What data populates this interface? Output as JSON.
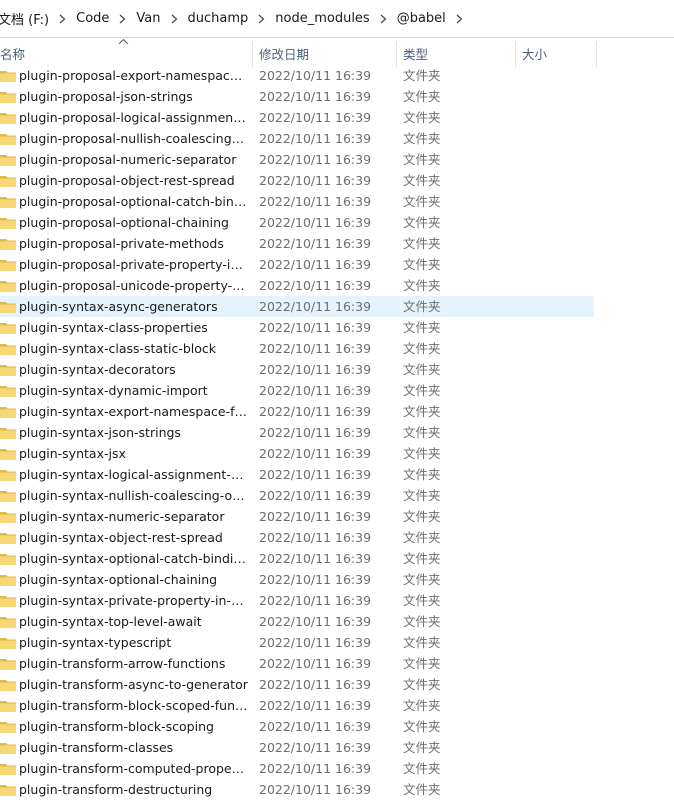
{
  "breadcrumb": [
    {
      "label": "文档 (F:)"
    },
    {
      "label": "Code"
    },
    {
      "label": "Van"
    },
    {
      "label": "duchamp"
    },
    {
      "label": "node_modules"
    },
    {
      "label": "@babel"
    }
  ],
  "columns": {
    "name": "名称",
    "date": "修改日期",
    "type": "类型",
    "size": "大小"
  },
  "colors": {
    "selected_row": "#e5f3ff",
    "folder": "#f8d775",
    "folder_dark": "#e0b94a",
    "header_text": "#4c607a"
  },
  "files": [
    {
      "name": "plugin-proposal-export-namespace-f...",
      "date": "2022/10/11 16:39",
      "type": "文件夹"
    },
    {
      "name": "plugin-proposal-json-strings",
      "date": "2022/10/11 16:39",
      "type": "文件夹"
    },
    {
      "name": "plugin-proposal-logical-assignment-...",
      "date": "2022/10/11 16:39",
      "type": "文件夹"
    },
    {
      "name": "plugin-proposal-nullish-coalescing-o...",
      "date": "2022/10/11 16:39",
      "type": "文件夹"
    },
    {
      "name": "plugin-proposal-numeric-separator",
      "date": "2022/10/11 16:39",
      "type": "文件夹"
    },
    {
      "name": "plugin-proposal-object-rest-spread",
      "date": "2022/10/11 16:39",
      "type": "文件夹"
    },
    {
      "name": "plugin-proposal-optional-catch-bindi...",
      "date": "2022/10/11 16:39",
      "type": "文件夹"
    },
    {
      "name": "plugin-proposal-optional-chaining",
      "date": "2022/10/11 16:39",
      "type": "文件夹"
    },
    {
      "name": "plugin-proposal-private-methods",
      "date": "2022/10/11 16:39",
      "type": "文件夹"
    },
    {
      "name": "plugin-proposal-private-property-in-...",
      "date": "2022/10/11 16:39",
      "type": "文件夹"
    },
    {
      "name": "plugin-proposal-unicode-property-r...",
      "date": "2022/10/11 16:39",
      "type": "文件夹"
    },
    {
      "name": "plugin-syntax-async-generators",
      "date": "2022/10/11 16:39",
      "type": "文件夹",
      "selected": true
    },
    {
      "name": "plugin-syntax-class-properties",
      "date": "2022/10/11 16:39",
      "type": "文件夹"
    },
    {
      "name": "plugin-syntax-class-static-block",
      "date": "2022/10/11 16:39",
      "type": "文件夹"
    },
    {
      "name": "plugin-syntax-decorators",
      "date": "2022/10/11 16:39",
      "type": "文件夹"
    },
    {
      "name": "plugin-syntax-dynamic-import",
      "date": "2022/10/11 16:39",
      "type": "文件夹"
    },
    {
      "name": "plugin-syntax-export-namespace-from",
      "date": "2022/10/11 16:39",
      "type": "文件夹"
    },
    {
      "name": "plugin-syntax-json-strings",
      "date": "2022/10/11 16:39",
      "type": "文件夹"
    },
    {
      "name": "plugin-syntax-jsx",
      "date": "2022/10/11 16:39",
      "type": "文件夹"
    },
    {
      "name": "plugin-syntax-logical-assignment-op...",
      "date": "2022/10/11 16:39",
      "type": "文件夹"
    },
    {
      "name": "plugin-syntax-nullish-coalescing-oper...",
      "date": "2022/10/11 16:39",
      "type": "文件夹"
    },
    {
      "name": "plugin-syntax-numeric-separator",
      "date": "2022/10/11 16:39",
      "type": "文件夹"
    },
    {
      "name": "plugin-syntax-object-rest-spread",
      "date": "2022/10/11 16:39",
      "type": "文件夹"
    },
    {
      "name": "plugin-syntax-optional-catch-binding",
      "date": "2022/10/11 16:39",
      "type": "文件夹"
    },
    {
      "name": "plugin-syntax-optional-chaining",
      "date": "2022/10/11 16:39",
      "type": "文件夹"
    },
    {
      "name": "plugin-syntax-private-property-in-obj...",
      "date": "2022/10/11 16:39",
      "type": "文件夹"
    },
    {
      "name": "plugin-syntax-top-level-await",
      "date": "2022/10/11 16:39",
      "type": "文件夹"
    },
    {
      "name": "plugin-syntax-typescript",
      "date": "2022/10/11 16:39",
      "type": "文件夹"
    },
    {
      "name": "plugin-transform-arrow-functions",
      "date": "2022/10/11 16:39",
      "type": "文件夹"
    },
    {
      "name": "plugin-transform-async-to-generator",
      "date": "2022/10/11 16:39",
      "type": "文件夹"
    },
    {
      "name": "plugin-transform-block-scoped-funct...",
      "date": "2022/10/11 16:39",
      "type": "文件夹"
    },
    {
      "name": "plugin-transform-block-scoping",
      "date": "2022/10/11 16:39",
      "type": "文件夹"
    },
    {
      "name": "plugin-transform-classes",
      "date": "2022/10/11 16:39",
      "type": "文件夹"
    },
    {
      "name": "plugin-transform-computed-properti...",
      "date": "2022/10/11 16:39",
      "type": "文件夹"
    },
    {
      "name": "plugin-transform-destructuring",
      "date": "2022/10/11 16:39",
      "type": "文件夹"
    }
  ]
}
